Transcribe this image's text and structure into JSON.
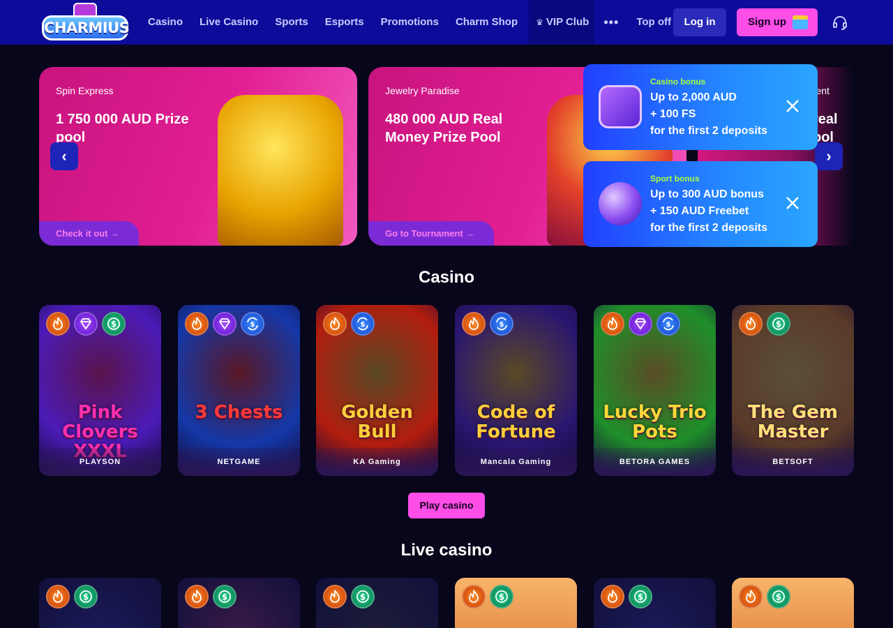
{
  "header": {
    "logo_text": "CHARMIUS",
    "nav": [
      "Casino",
      "Live Casino",
      "Sports",
      "Esports",
      "Promotions",
      "Charm Shop"
    ],
    "vip": "VIP Club",
    "more": "•••",
    "topoff": "Top off",
    "login": "Log in",
    "signup": "Sign up"
  },
  "carousel": {
    "banners": [
      {
        "category": "Spin Express",
        "title": "1 750 000 AUD Prize pool",
        "cta": "Check it out"
      },
      {
        "category": "Jewelry Paradise",
        "title": "480 000 AUD Real Money Prize Pool",
        "cta": "Go to Tournament"
      }
    ],
    "partial": {
      "category": "ament",
      "title": "real ool"
    }
  },
  "bonuses": [
    {
      "label": "Casino bonus",
      "line1": "Up to 2,000 AUD",
      "line2": "+ 100 FS",
      "line3": "for the first 2 deposits"
    },
    {
      "label": "Sport bonus",
      "line1": "Up to 300 AUD bonus",
      "line2": "+ 150 AUD Freebet",
      "line3": "for the first 2 deposits"
    }
  ],
  "casino": {
    "title": "Casino",
    "games": [
      {
        "name": "Pink Clovers XXXL",
        "provider": "PLAYSON",
        "bg": "#4b1bb8",
        "color": "#ff2fb0",
        "badges": [
          "fire",
          "gem",
          "dollar"
        ]
      },
      {
        "name": "3 Chests",
        "provider": "NETGAME",
        "bg": "#1438a8",
        "color": "#ff3a3a",
        "badges": [
          "fire",
          "gem",
          "swap"
        ]
      },
      {
        "name": "Golden Bull",
        "provider": "KA Gaming",
        "bg": "#b21d0e",
        "color": "#ffcf3a",
        "badges": [
          "fire",
          "swap"
        ]
      },
      {
        "name": "Code of Fortune",
        "provider": "Mancala Gaming",
        "bg": "#2a1670",
        "color": "#ffcf3a",
        "badges": [
          "fire",
          "swap"
        ]
      },
      {
        "name": "Lucky Trio Pots",
        "provider": "BETORA GAMES",
        "bg": "#1f8f2a",
        "color": "#ffd83a",
        "badges": [
          "fire",
          "gem",
          "swap"
        ]
      },
      {
        "name": "The Gem Master",
        "provider": "BETSOFT",
        "bg": "#5a3a28",
        "color": "#ffe07a",
        "badges": [
          "fire",
          "dollar"
        ]
      }
    ],
    "play": "Play casino"
  },
  "live": {
    "title": "Live casino",
    "tiles": [
      "#1b1a5a",
      "#3a1a4a",
      "#1d1d3a",
      "#f3a85a",
      "#1b1a5a",
      "#f3a85a"
    ]
  }
}
